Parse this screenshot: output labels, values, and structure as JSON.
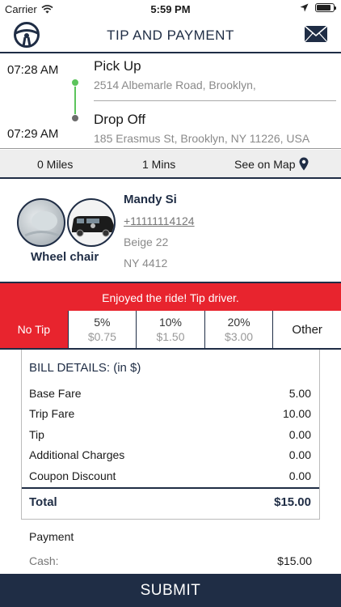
{
  "status_bar": {
    "carrier": "Carrier",
    "time": "5:59 PM"
  },
  "header": {
    "title": "TIP AND PAYMENT",
    "left_icon": "steering-wheel-icon",
    "right_icon": "mail-icon"
  },
  "trip": {
    "pickup_time": "07:28 AM",
    "pickup_label": "Pick Up",
    "pickup_address": "2514 Albemarle Road, Brooklyn,",
    "dropoff_time": "07:29 AM",
    "dropoff_label": "Drop Off",
    "dropoff_address": "185 Erasmus St, Brooklyn, NY 11226, USA"
  },
  "stats": {
    "miles": "0 Miles",
    "mins": "1 Mins",
    "map_link": "See on Map"
  },
  "driver": {
    "name": "Mandy Si",
    "phone": "+11111114124",
    "car": "Beige 22",
    "plate": "NY 4412",
    "vehicle_type": "Wheel chair"
  },
  "tip": {
    "banner": "Enjoyed the ride! Tip driver.",
    "options": [
      {
        "label": "No Tip"
      },
      {
        "pct": "5%",
        "amt": "$0.75"
      },
      {
        "pct": "10%",
        "amt": "$1.50"
      },
      {
        "pct": "20%",
        "amt": "$3.00"
      },
      {
        "label": "Other"
      }
    ]
  },
  "bill": {
    "heading": "BILL DETAILS: (in  $)",
    "rows": [
      {
        "label": "Base Fare",
        "value": "5.00"
      },
      {
        "label": "Trip Fare",
        "value": "10.00"
      },
      {
        "label": "Tip",
        "value": "0.00"
      },
      {
        "label": "Additional Charges",
        "value": "0.00"
      },
      {
        "label": "Coupon Discount",
        "value": "0.00"
      }
    ],
    "total_label": "Total",
    "total_value": "$15.00"
  },
  "payment": {
    "label": "Payment",
    "method": "Cash:",
    "amount": "$15.00"
  },
  "submit_label": "SUBMIT",
  "colors": {
    "navy": "#1f2d45",
    "red": "#e8242e",
    "green": "#5cc45c"
  }
}
